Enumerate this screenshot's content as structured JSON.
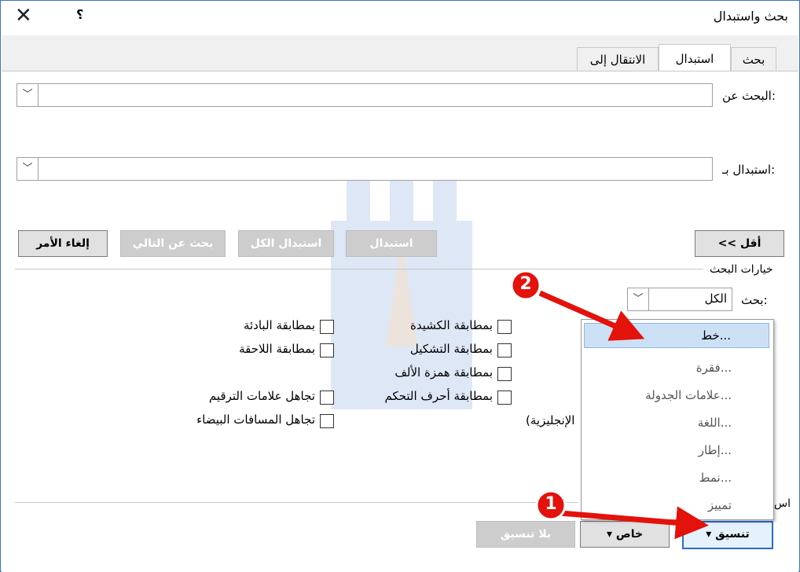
{
  "window": {
    "title": "بحث واستبدال",
    "help_label": "؟",
    "close_label": "✕"
  },
  "tabs": [
    {
      "label": "بحث",
      "active": false
    },
    {
      "label": "استبدال",
      "active": true
    },
    {
      "label": "الانتقال إلى",
      "active": false
    }
  ],
  "find": {
    "label": "البحث عن:",
    "value": ""
  },
  "replace": {
    "label": "استبدال بـ:",
    "value": ""
  },
  "buttons": {
    "less": "<< أقل",
    "replace": "استبدال",
    "replace_all": "استبدال الكل",
    "find_next": "بحث عن التالي",
    "cancel": "إلغاء الأمر",
    "format": "تنسيق",
    "special": "خاص",
    "no_format": "بلا تنسيق"
  },
  "options": {
    "heading": "خيارات البحث",
    "search_label": "بحث:",
    "search_value": "الكل",
    "checkboxes_middle": [
      "بمطابقة الكشيدة",
      "بمطابقة التشكيل",
      "بمطابقة همزة الألف",
      "بمطابقة أحرف التحكم"
    ],
    "checkboxes_left": [
      "بمطابقة البادئة",
      "بمطابقة اللاحقة",
      "تجاهل علامات الترقيم",
      "تجاهل المسافات البيضاء"
    ],
    "partial_text": "(الإنجليزية",
    "replace_section_label": "اس"
  },
  "format_menu": {
    "items": [
      "خط...",
      "فقرة...",
      "علامات الجدولة...",
      "اللغة...",
      "إطار...",
      "نمط...",
      "تمييز"
    ],
    "highlighted_index": 0
  },
  "annotations": {
    "marker_1": "1",
    "marker_2": "2",
    "color": "#e3120b"
  }
}
